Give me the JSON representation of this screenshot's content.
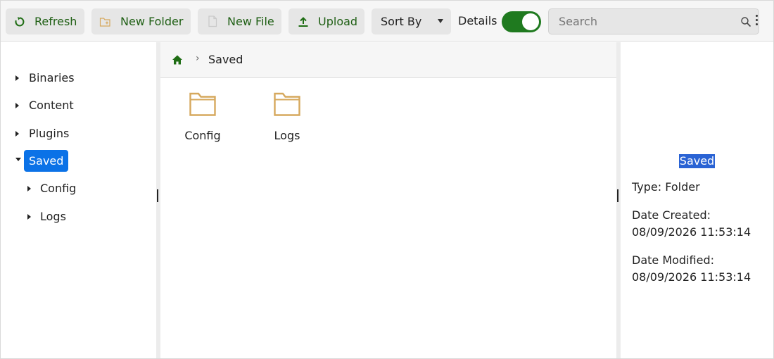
{
  "toolbar": {
    "refresh_label": "Refresh",
    "new_folder_label": "New Folder",
    "new_file_label": "New File",
    "upload_label": "Upload",
    "sort_label": "Sort By",
    "details_label": "Details",
    "details_on": true,
    "search_placeholder": "Search",
    "accent_color": "#1f7a1f"
  },
  "nav": {
    "items": [
      {
        "label": "Binaries",
        "expanded": false
      },
      {
        "label": "Content",
        "expanded": false
      },
      {
        "label": "Plugins",
        "expanded": false
      },
      {
        "label": "Saved",
        "expanded": true,
        "selected": true
      },
      {
        "label": "Config",
        "expanded": false
      },
      {
        "label": "Logs",
        "expanded": false
      }
    ]
  },
  "breadcrumb": {
    "separator": "›",
    "current": "Saved"
  },
  "files": [
    {
      "name": "Config",
      "icon": "folder-icon"
    },
    {
      "name": "Logs",
      "icon": "folder-icon"
    }
  ],
  "details": {
    "title": "Saved",
    "type_line": "Type: Folder",
    "created_label": "Date Created:",
    "created_value": "08/09/2026 11:53:14",
    "modified_label": "Date Modified:",
    "modified_value": "08/09/2026 11:53:14"
  }
}
